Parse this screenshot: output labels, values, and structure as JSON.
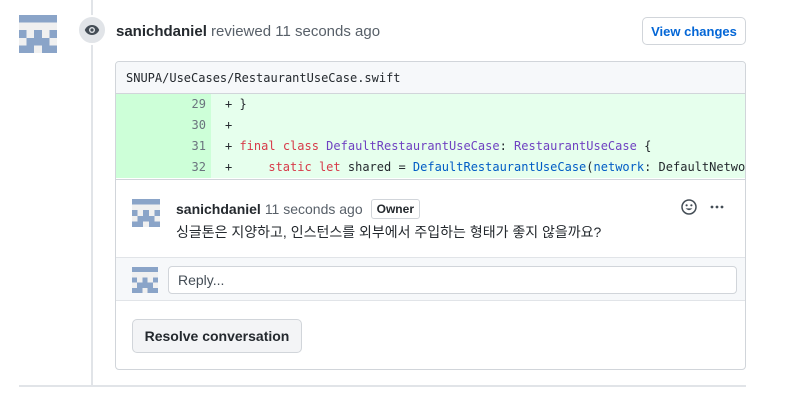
{
  "review": {
    "author": "sanichdaniel",
    "action": "reviewed",
    "time": "11 seconds ago",
    "view_changes_label": "View changes",
    "icon": "eye-icon"
  },
  "file": {
    "path": "SNUPA/UseCases/RestaurantUseCase.swift",
    "lines": [
      {
        "num": "29",
        "code": "+ }"
      },
      {
        "num": "30",
        "code": "+"
      },
      {
        "num": "31",
        "code": "+ final class DefaultRestaurantUseCase: RestaurantUseCase {"
      },
      {
        "num": "32",
        "code": "+     static let shared = DefaultRestaurantUseCase(network: DefaultNetwo"
      }
    ]
  },
  "comment": {
    "author": "sanichdaniel",
    "time": "11 seconds ago",
    "badge": "Owner",
    "body": "싱글톤은 지양하고, 인스턴스를 외부에서 주입하는 형태가 좋지 않을까요?",
    "emoji_icon": "smiley-icon",
    "more_icon": "kebab-horizontal-icon"
  },
  "reply": {
    "placeholder": "Reply..."
  },
  "resolve_label": "Resolve conversation",
  "colors": {
    "link": "#0366d6",
    "addition_bg": "#e6ffed",
    "addition_num_bg": "#cdffd8",
    "identicon": "#8aa4c8"
  }
}
